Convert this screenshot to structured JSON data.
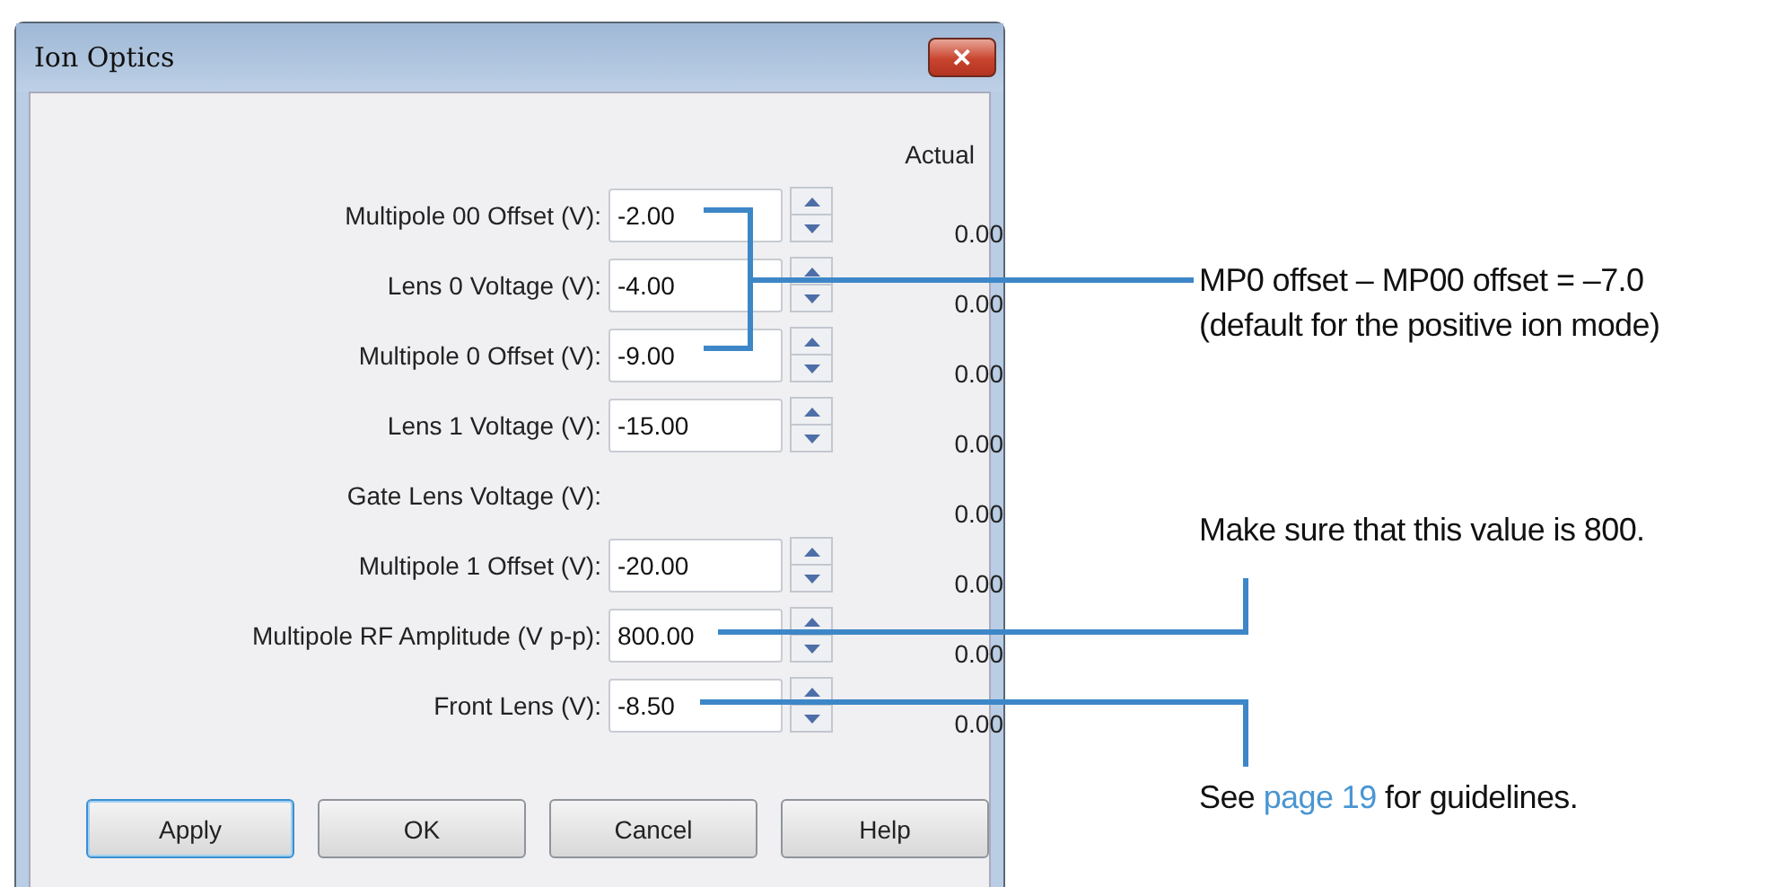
{
  "window": {
    "title": "Ion Optics",
    "close": "✕"
  },
  "actual_header": "Actual",
  "rows": [
    {
      "kind": "input",
      "label": "Multipole 00 Offset (V):",
      "value": "-2.00",
      "actual": "0.00"
    },
    {
      "kind": "input",
      "label": "Lens 0 Voltage (V):",
      "value": "-4.00",
      "actual": "0.00"
    },
    {
      "kind": "input",
      "label": "Multipole 0 Offset (V):",
      "value": "-9.00",
      "actual": "0.00"
    },
    {
      "kind": "input",
      "label": "Lens 1 Voltage (V):",
      "value": "-15.00",
      "actual": "0.00"
    },
    {
      "kind": "readonly",
      "label": "Gate Lens Voltage (V):",
      "actual": "0.00"
    },
    {
      "kind": "input",
      "label": "Multipole 1 Offset (V):",
      "value": "-20.00",
      "actual": "0.00"
    },
    {
      "kind": "input",
      "label": "Multipole RF Amplitude (V p-p):",
      "value": "800.00",
      "actual": "0.00"
    },
    {
      "kind": "input",
      "label": "Front Lens (V):",
      "value": "-8.50",
      "actual": "0.00"
    }
  ],
  "buttons": [
    {
      "label": "Apply",
      "focused": true
    },
    {
      "label": "OK",
      "focused": false
    },
    {
      "label": "Cancel",
      "focused": false
    },
    {
      "label": "Help",
      "focused": false
    }
  ],
  "annotations": [
    {
      "lines": [
        "MP0 offset – MP00 offset = –7.0",
        "(default for the positive ion mode)"
      ]
    },
    {
      "lines": [
        "Make sure that this value is 800."
      ]
    },
    {
      "before": "See",
      "link": "page 19",
      "after": "for guidelines."
    }
  ]
}
